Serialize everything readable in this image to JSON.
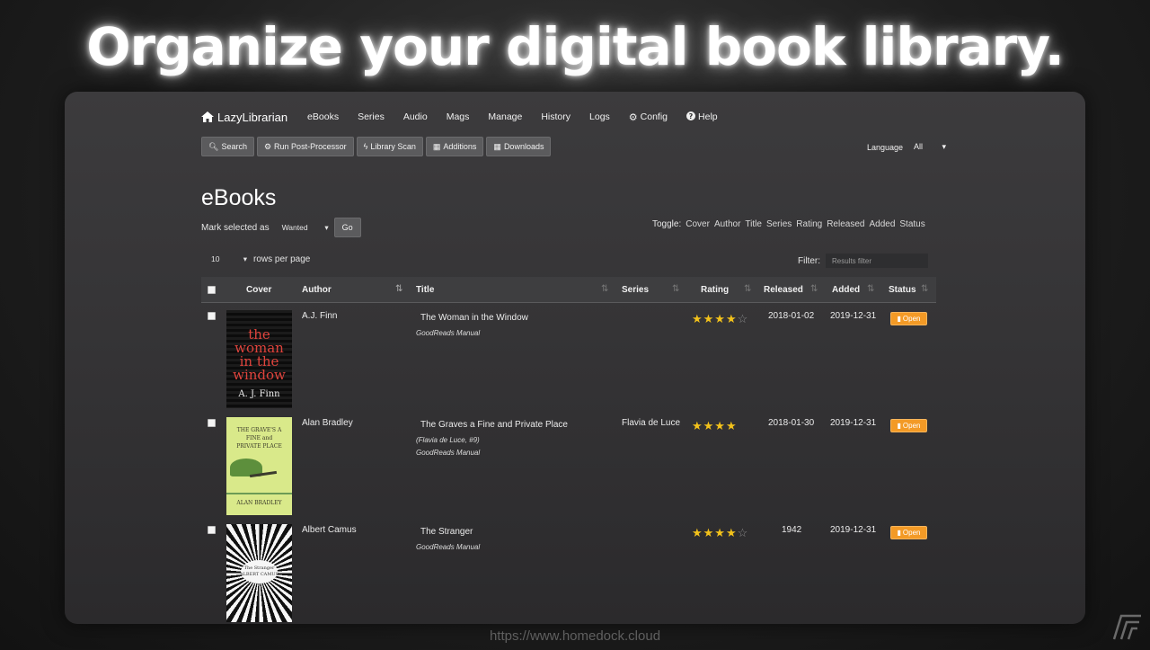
{
  "headline": "Organize your digital book library.",
  "footer_url": "https://www.homedock.cloud",
  "nav": {
    "brand": "LazyLibrarian",
    "items": [
      {
        "label": "eBooks",
        "icon": ""
      },
      {
        "label": "Series",
        "icon": ""
      },
      {
        "label": "Audio",
        "icon": ""
      },
      {
        "label": "Mags",
        "icon": ""
      },
      {
        "label": "Manage",
        "icon": ""
      },
      {
        "label": "History",
        "icon": ""
      },
      {
        "label": "Logs",
        "icon": ""
      },
      {
        "label": "Config",
        "icon": "gear-icon"
      },
      {
        "label": "Help",
        "icon": "question-circle-icon"
      }
    ]
  },
  "toolbar": {
    "buttons": [
      {
        "label": "Search",
        "icon": "search-icon"
      },
      {
        "label": "Run Post-Processor",
        "icon": "gears-icon"
      },
      {
        "label": "Library Scan",
        "icon": "bolt-icon"
      },
      {
        "label": "Additions",
        "icon": "calendar-icon"
      },
      {
        "label": "Downloads",
        "icon": "calendar-icon"
      }
    ]
  },
  "language": {
    "label": "Language",
    "selected": "All"
  },
  "page_title": "eBooks",
  "mark": {
    "label": "Mark selected as",
    "selected": "Wanted",
    "go": "Go"
  },
  "toggle": {
    "label": "Toggle:",
    "columns": [
      "Cover",
      "Author",
      "Title",
      "Series",
      "Rating",
      "Released",
      "Added",
      "Status"
    ]
  },
  "pagination": {
    "rows_value": "10",
    "rows_label": "rows per page"
  },
  "filter": {
    "label": "Filter:",
    "placeholder": "Results filter"
  },
  "columns": {
    "cover": "Cover",
    "author": "Author",
    "title": "Title",
    "series": "Series",
    "rating": "Rating",
    "released": "Released",
    "added": "Added",
    "status": "Status"
  },
  "books": [
    {
      "author": "A.J. Finn",
      "title": "The Woman in the Window",
      "series_note": "",
      "source": "GoodReads Manual",
      "series": "",
      "rating": 4,
      "released": "2018-01-02",
      "added": "2019-12-31",
      "status": "Open",
      "cover": {
        "line1": "the",
        "line2": "woman",
        "line3": "in the",
        "line4": "window",
        "author": "A. J. Finn"
      }
    },
    {
      "author": "Alan Bradley",
      "title": "The Graves a Fine and Private Place",
      "series_note": "(Flavia de Luce, #9)",
      "source": "GoodReads Manual",
      "series": "Flavia de Luce",
      "rating": 4,
      "released": "2018-01-30",
      "added": "2019-12-31",
      "status": "Open",
      "cover": {
        "line1": "THE GRAVE'S A",
        "line2": "FINE and",
        "line3": "PRIVATE PLACE",
        "author": "ALAN BRADLEY"
      }
    },
    {
      "author": "Albert Camus",
      "title": "The Stranger",
      "series_note": "",
      "source": "GoodReads Manual",
      "series": "",
      "rating": 4,
      "released": "1942",
      "added": "2019-12-31",
      "status": "Open",
      "cover": {
        "line1": "The Stranger",
        "line2": "ALBERT CAMUS"
      }
    }
  ],
  "colors": {
    "open_button": "#f39a26",
    "star": "#f3c21b",
    "panel": "#353436"
  }
}
